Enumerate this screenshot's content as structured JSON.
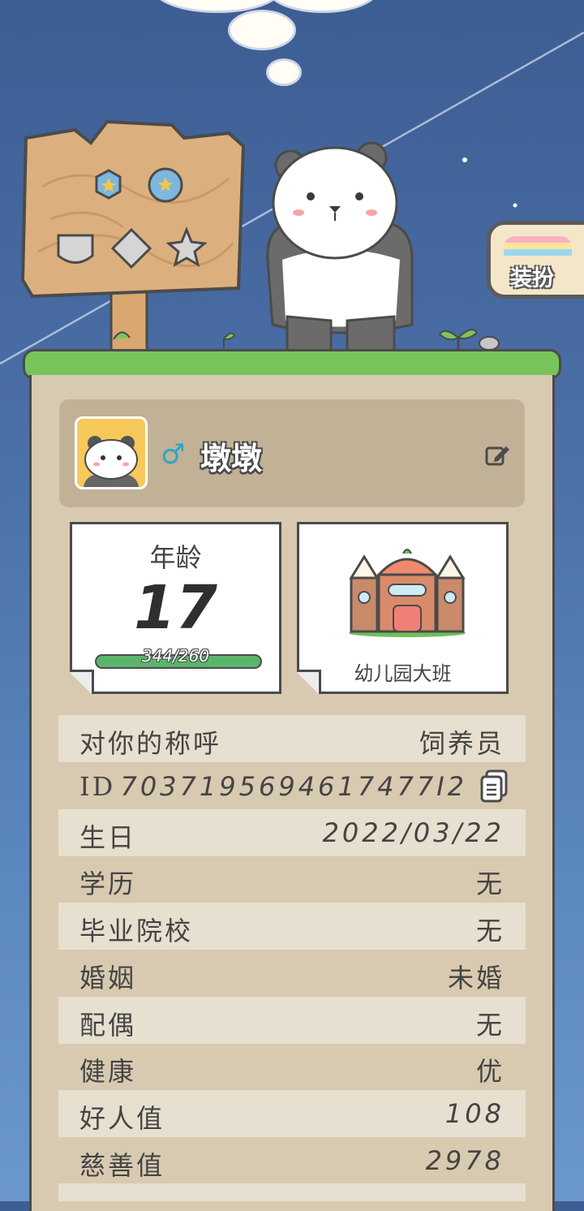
{
  "colors": {
    "sky_top": "#3d5e93",
    "sky_bottom": "#6a97cd",
    "grass": "#78c45a",
    "panel": "#d8cab0",
    "gender_male": "#2aa7c8",
    "progress": "#5ab56a"
  },
  "dress_up": {
    "label": "装扮"
  },
  "profile": {
    "gender_icon": "male-symbol-icon",
    "gender_symbol": "♂",
    "name": "墩墩"
  },
  "age_card": {
    "title": "年龄",
    "value": "17",
    "progress_text": "344/260",
    "progress_fraction": 1.0
  },
  "school_card": {
    "label": "幼儿园大班"
  },
  "info_rows": [
    {
      "key": "对你的称呼",
      "value": "饲养员"
    },
    {
      "key": "ID",
      "value": "7037195694617477I2"
    },
    {
      "key": "生日",
      "value": "2022/03/22"
    },
    {
      "key": "学历",
      "value": "无"
    },
    {
      "key": "毕业院校",
      "value": "无"
    },
    {
      "key": "婚姻",
      "value": "未婚"
    },
    {
      "key": "配偶",
      "value": "无"
    },
    {
      "key": "健康",
      "value": "优"
    },
    {
      "key": "好人值",
      "value": "108"
    },
    {
      "key": "慈善值",
      "value": "2978"
    }
  ]
}
